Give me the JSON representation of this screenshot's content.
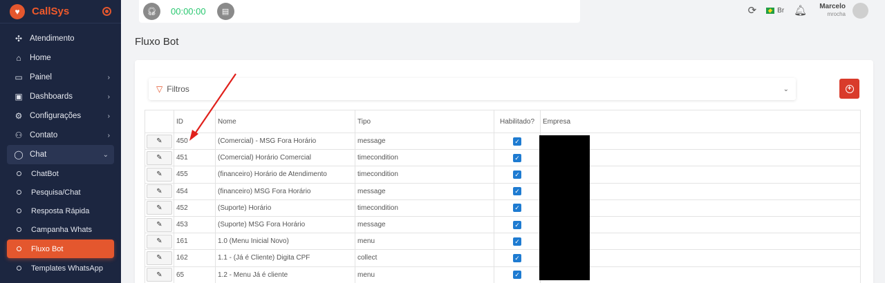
{
  "brand": {
    "name": "CallSys"
  },
  "sidebar": {
    "items": [
      {
        "label": "Atendimento",
        "icon": "grid-icon"
      },
      {
        "label": "Home",
        "icon": "home-icon"
      },
      {
        "label": "Painel",
        "icon": "monitor-icon",
        "chevron": "›"
      },
      {
        "label": "Dashboards",
        "icon": "chart-icon",
        "chevron": "›"
      },
      {
        "label": "Configurações",
        "icon": "gear-icon",
        "chevron": "›"
      },
      {
        "label": "Contato",
        "icon": "users-icon",
        "chevron": "›"
      },
      {
        "label": "Chat",
        "icon": "chat-bubble-icon",
        "chevron": "⌄"
      }
    ],
    "subitems": [
      "ChatBot",
      "Pesquisa/Chat",
      "Resposta Rápida",
      "Campanha Whats",
      "Fluxo Bot",
      "Templates WhatsApp"
    ]
  },
  "callbar": {
    "timer": "00:00:00"
  },
  "header": {
    "lang": "Br",
    "user_name": "Marcelo",
    "user_login": "mrocha"
  },
  "page": {
    "title": "Fluxo Bot"
  },
  "filters": {
    "label": "Filtros"
  },
  "table": {
    "headers": {
      "id": "ID",
      "nome": "Nome",
      "tipo": "Tipo",
      "habilitado": "Habilitado?",
      "empresa": "Empresa"
    },
    "rows": [
      {
        "id": "450",
        "nome": "(Comercial) - MSG Fora Horário",
        "tipo": "message",
        "habilitado": true
      },
      {
        "id": "451",
        "nome": "(Comercial) Horário Comercial",
        "tipo": "timecondition",
        "habilitado": true
      },
      {
        "id": "455",
        "nome": "(financeiro) Horário de Atendimento",
        "tipo": "timecondition",
        "habilitado": true
      },
      {
        "id": "454",
        "nome": "(financeiro) MSG Fora Horário",
        "tipo": "message",
        "habilitado": true
      },
      {
        "id": "452",
        "nome": "(Suporte) Horário",
        "tipo": "timecondition",
        "habilitado": true
      },
      {
        "id": "453",
        "nome": "(Suporte) MSG Fora Horário",
        "tipo": "message",
        "habilitado": true
      },
      {
        "id": "161",
        "nome": "1.0 (Menu Inicial Novo)",
        "tipo": "menu",
        "habilitado": true
      },
      {
        "id": "162",
        "nome": "1.1 - (Já é Cliente) Digita CPF",
        "tipo": "collect",
        "habilitado": true
      },
      {
        "id": "65",
        "nome": "1.2 - Menu Já é cliente",
        "tipo": "menu",
        "habilitado": true
      }
    ]
  },
  "colors": {
    "accent": "#e4572e",
    "sidebar_bg": "#1c2640",
    "checkbox": "#1e7bd1",
    "timer": "#28c76f",
    "annotation_arrow": "#e0201b"
  }
}
